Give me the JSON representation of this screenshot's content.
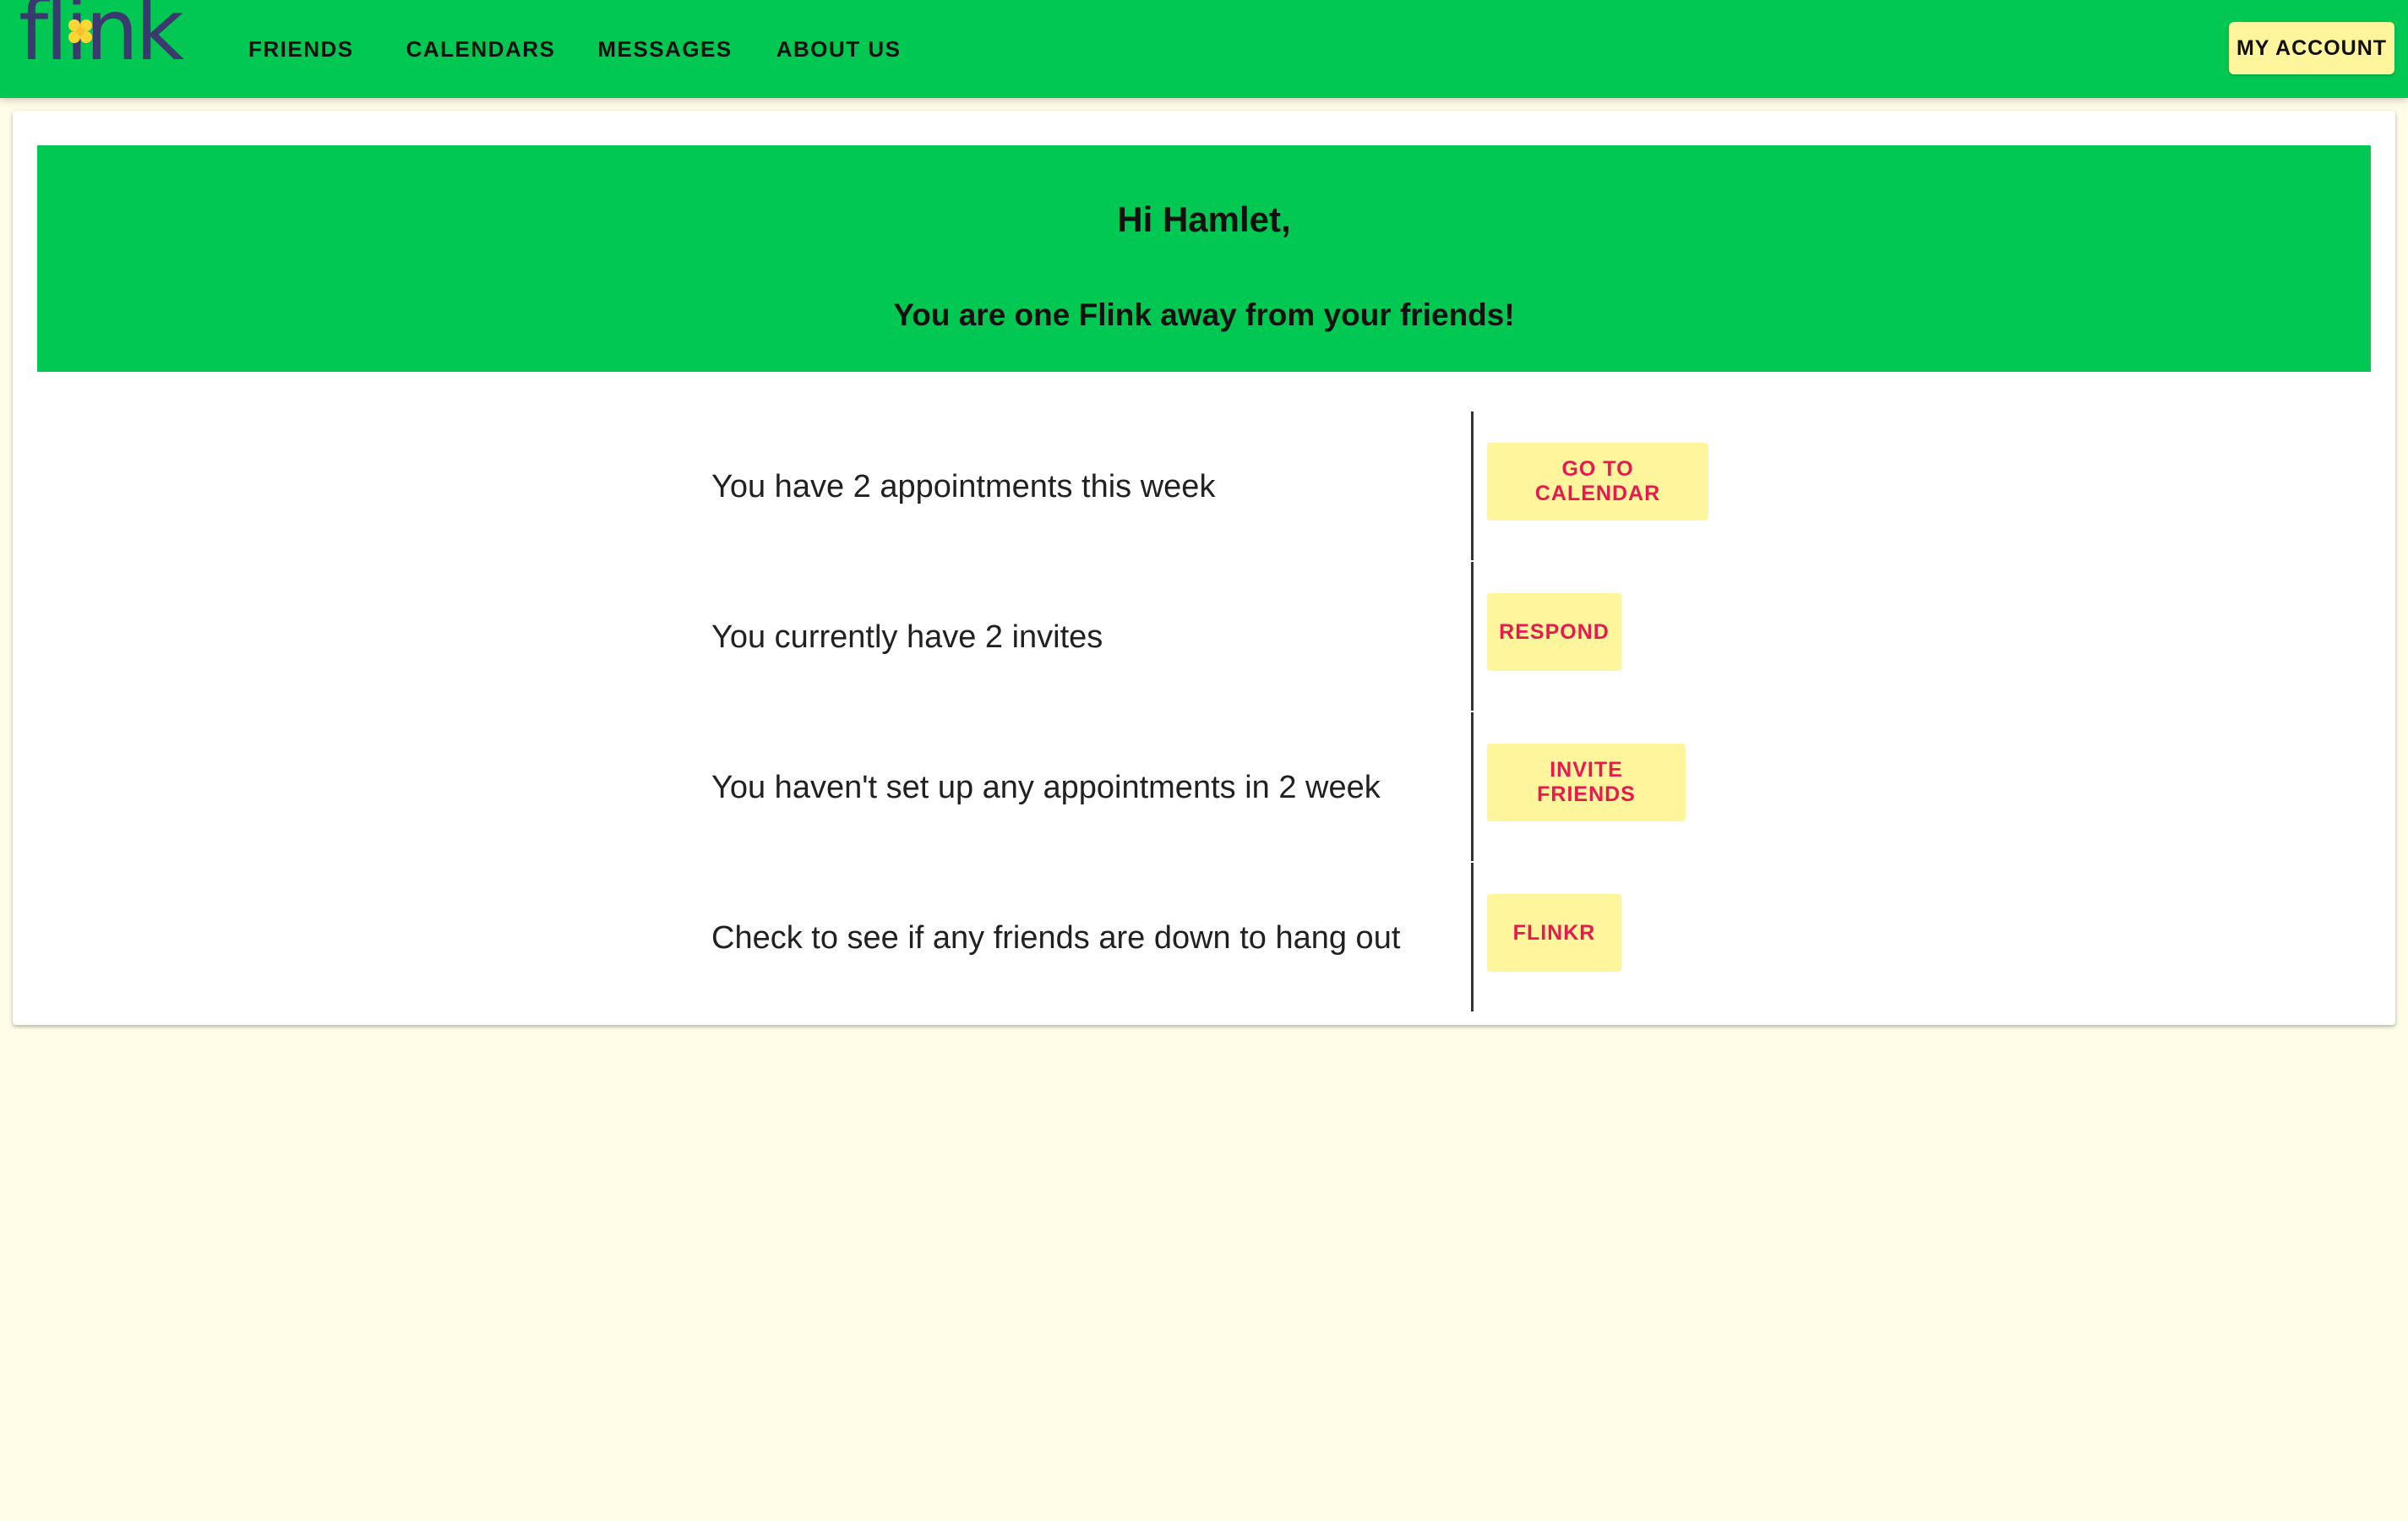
{
  "brand": {
    "logo_text": "flink",
    "primary_color": "#00c853",
    "accent_color": "#fff59d",
    "button_text_color": "#e8194f",
    "background_color": "#fffde7"
  },
  "nav": {
    "items": [
      {
        "label": "FRIENDS"
      },
      {
        "label": "CALENDARS"
      },
      {
        "label": "MESSAGES"
      },
      {
        "label": "ABOUT US"
      }
    ],
    "account_label": "MY ACCOUNT"
  },
  "banner": {
    "greeting": "Hi Hamlet,",
    "tagline": "You are one Flink away from your friends!"
  },
  "rows": [
    {
      "text": "You have 2 appointments this week",
      "button": "GO TO CALENDAR"
    },
    {
      "text": "You currently have 2 invites",
      "button": "RESPOND"
    },
    {
      "text": "You haven't set up any appointments in 2 week",
      "button": "INVITE FRIENDS"
    },
    {
      "text": "Check to see if any friends are down to hang out",
      "button": "FLINKR"
    }
  ]
}
